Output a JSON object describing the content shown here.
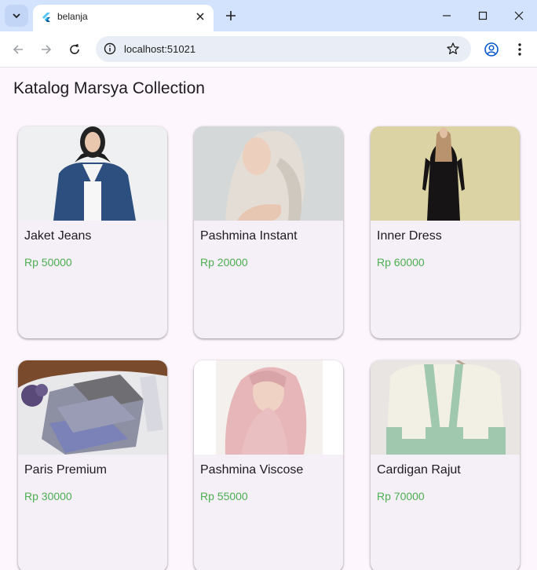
{
  "browser": {
    "tab_title": "belanja",
    "url": "localhost:51021"
  },
  "page": {
    "title": "Katalog Marsya Collection"
  },
  "products": [
    {
      "name": "Jaket Jeans",
      "price": "Rp 50000"
    },
    {
      "name": "Pashmina Instant",
      "price": "Rp 20000"
    },
    {
      "name": "Inner Dress",
      "price": "Rp 60000"
    },
    {
      "name": "Paris Premium",
      "price": "Rp 30000"
    },
    {
      "name": "Pashmina Viscose",
      "price": "Rp 55000"
    },
    {
      "name": "Cardigan Rajut",
      "price": "Rp 70000"
    }
  ],
  "colors": {
    "price": "#4caf50",
    "page_bg": "#fdf6fd",
    "card_bg": "#f5eff7",
    "tabbar": "#d3e3fd"
  }
}
